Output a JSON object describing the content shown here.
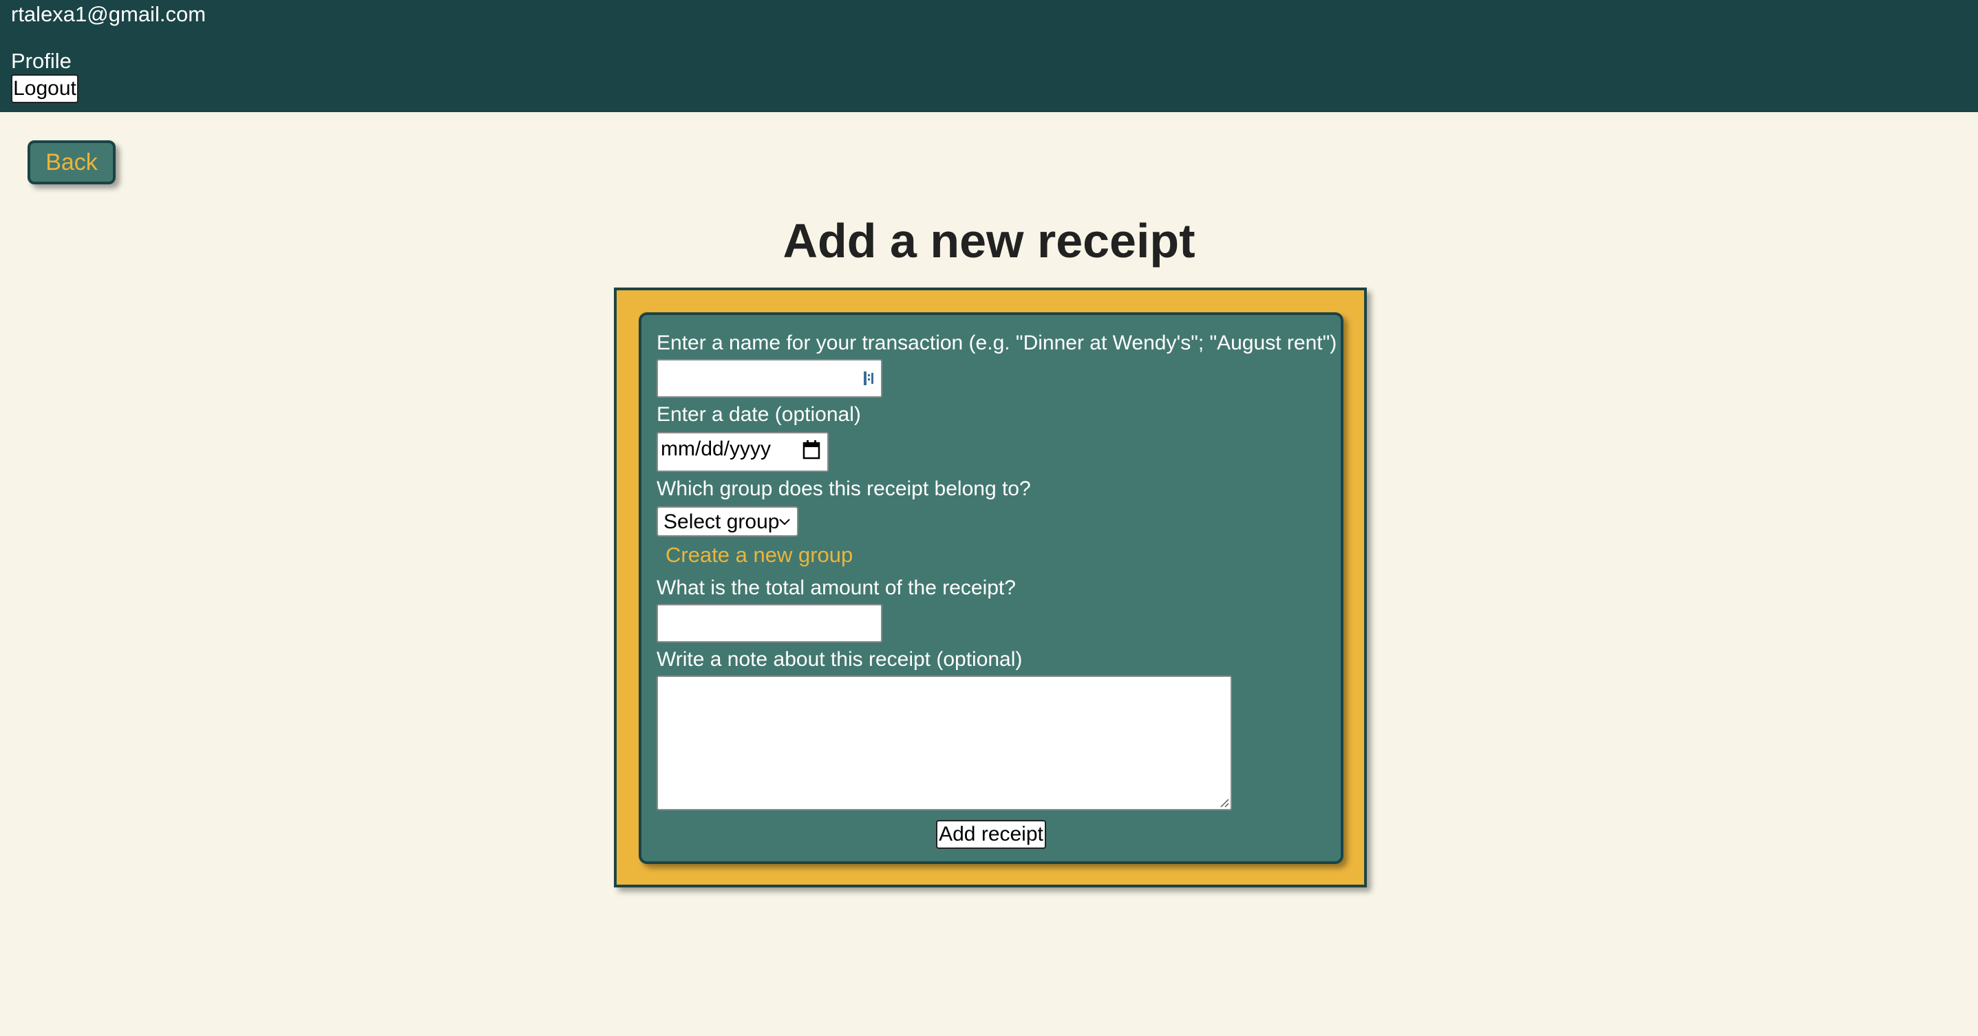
{
  "header": {
    "email": "rtalexa1@gmail.com",
    "profile_label": "Profile",
    "logout_label": "Logout"
  },
  "nav": {
    "back_label": "Back"
  },
  "page": {
    "title": "Add a new receipt"
  },
  "form": {
    "name_label": "Enter a name for your transaction (e.g. \"Dinner at Wendy's\"; \"August rent\")",
    "name_value": "",
    "date_label": "Enter a date (optional)",
    "date_placeholder": "mm/dd/yyyy",
    "group_label": "Which group does this receipt belong to?",
    "group_selected": "Select group",
    "create_group_label": "Create a new group",
    "amount_label": "What is the total amount of the receipt?",
    "amount_value": "",
    "note_label": "Write a note about this receipt (optional)",
    "note_value": "",
    "submit_label": "Add receipt"
  },
  "colors": {
    "header_bg": "#1b4446",
    "page_bg": "#f8f5e8",
    "card_outer": "#ecb53c",
    "card_inner": "#437870",
    "accent_text": "#ecb53c"
  }
}
